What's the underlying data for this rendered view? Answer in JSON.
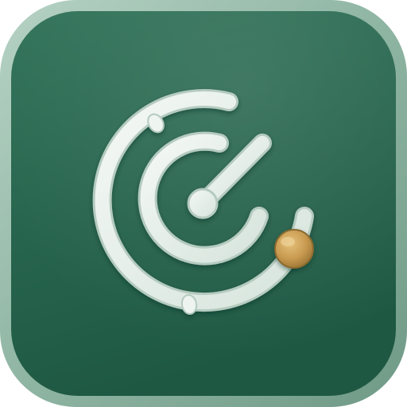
{
  "icon": {
    "name": "radar-gauge-app-icon",
    "glyph": "radar-icon",
    "colors": {
      "frame": "#8fb5a3",
      "tile_top": "#2f6e55",
      "tile_bottom": "#1f5a45",
      "arc": "#e3ede7",
      "arc_shadow": "#9bb8aa",
      "knob": "#cfa35a",
      "knob_shadow": "#9a7435"
    }
  }
}
